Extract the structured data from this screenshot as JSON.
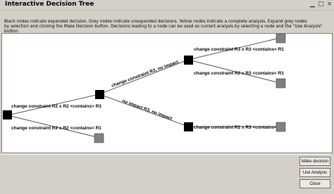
{
  "window": {
    "title": "Interactive Decision Tree",
    "controls": [
      "minimize-icon",
      "maximize-icon",
      "close-icon"
    ]
  },
  "info_lines": [
    "Black nodes indicate expanded decision. Grey nodes indicate unexpanded decisions. Yellow nodes indicate a complete analysis. Expand grey nodes",
    "by selection and clicking the Make Decision button. Decisions leading to a node can be used as current analysis by selecting a node and the \"Use Analysis\" button."
  ],
  "tree": {
    "edges": [
      {
        "label": "change constraint R2 x R2 <contains> R3"
      },
      {
        "label": "change constraint R2 x R2 <contains< R1"
      },
      {
        "label": "change constraint R3, no impact"
      },
      {
        "label": "no impact R3, no impact"
      },
      {
        "label": "change constraint R3 x R3 <contains< R1"
      },
      {
        "label": "change constraint R2 x R3 <contains< R1"
      },
      {
        "label": "change constraint R2 x R3 <contains< R1"
      }
    ]
  },
  "buttons": {
    "make_decision": "Make decision",
    "use_analysis": "Use Analysis",
    "close": "Close"
  },
  "colors": {
    "expanded_node": "#000000",
    "unexpanded_node": "#808080",
    "edge": "#555555"
  }
}
